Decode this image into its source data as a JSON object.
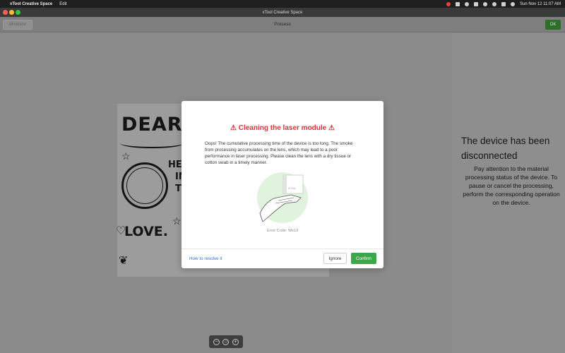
{
  "menubar": {
    "app_name": "xTool Creative Space",
    "edit": "Edit",
    "clock": "Sun Nov 12  11:07 AM"
  },
  "window": {
    "title": "xTool Creative Space"
  },
  "toolbar": {
    "minimize_label": "Minimize",
    "title": "Process",
    "ok_label": "OK"
  },
  "canvas": {
    "design_heading": "DEAR SA",
    "design_love": "LOVE.",
    "design_letters": [
      "HER",
      "IN",
      "T"
    ]
  },
  "panel": {
    "title": "The device has been disconnected",
    "description": "Pay attention to the material processing status of the device. To pause or cancel the processing, perform the corresponding operation on the device."
  },
  "modal": {
    "title": "⚠ Cleaning the laser module ⚠",
    "body": "Oops! The cumulative processing time of the device is too long. The smoke from processing accumulates on the lens, which may lead to a poor performance in laser processing. Please clean the lens with a dry tissue or cotton swab in a timely manner.",
    "device_brand": "xTOOL",
    "error_code": "Error Code: Wx13",
    "help_link": "How to resolve it",
    "ignore_label": "Ignore",
    "confirm_label": "Confirm"
  },
  "zoom": {
    "zoom_out": "−",
    "zoom_reset": "○",
    "zoom_in": "+"
  },
  "colors": {
    "accent_green": "#3ca64a",
    "warning_red": "#e0303a",
    "link_blue": "#2d6fd1"
  }
}
